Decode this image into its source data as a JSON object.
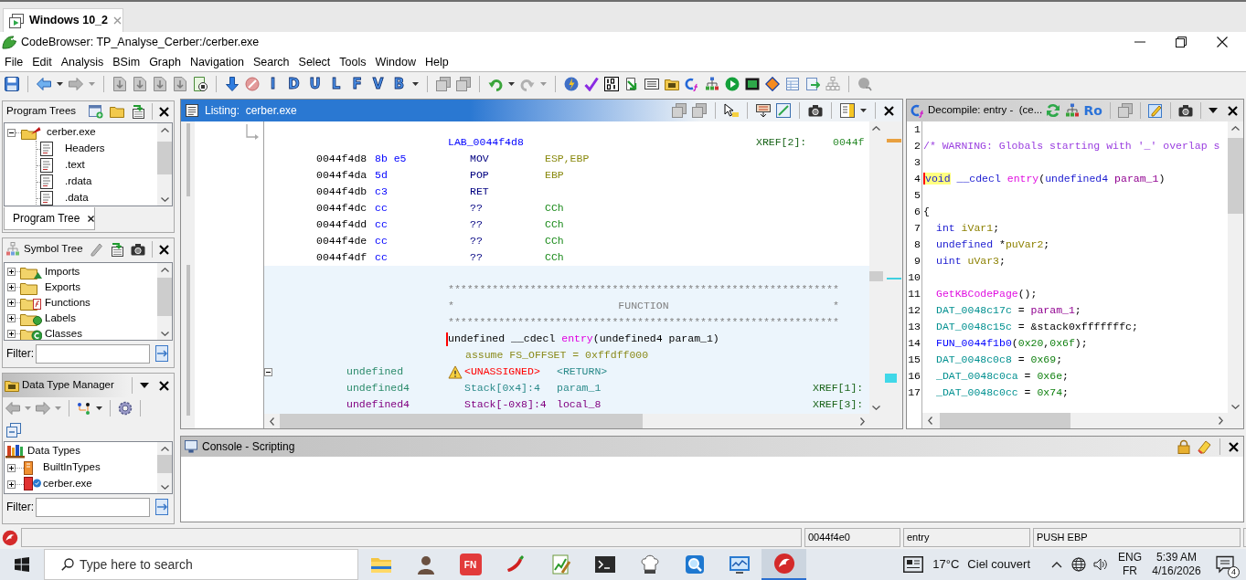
{
  "tabs": [
    {
      "title": "Windows 10_2",
      "selected": true
    }
  ],
  "window": {
    "title": "CodeBrowser: TP_Analyse_Cerber:/cerber.exe"
  },
  "menu": [
    "File",
    "Edit",
    "Analysis",
    "BSim",
    "Graph",
    "Navigation",
    "Search",
    "Select",
    "Tools",
    "Window",
    "Help"
  ],
  "toolbar": {
    "letter_buttons": [
      "I",
      "D",
      "U",
      "L",
      "F",
      "V",
      "B"
    ]
  },
  "program_trees": {
    "title": "Program Trees",
    "tree": [
      {
        "label": "cerber.exe",
        "expanded": true,
        "children": [
          {
            "label": "Headers"
          },
          {
            "label": ".text"
          },
          {
            "label": ".rdata"
          },
          {
            "label": ".data"
          }
        ]
      }
    ],
    "tabs": [
      {
        "label": "Program Tree",
        "selected": true
      }
    ]
  },
  "symbol_tree": {
    "title": "Symbol Tree",
    "items": [
      {
        "label": "Imports",
        "expanded": false
      },
      {
        "label": "Exports",
        "expanded": false
      },
      {
        "label": "Functions",
        "expanded": false
      },
      {
        "label": "Labels",
        "expanded": false
      },
      {
        "label": "Classes",
        "expanded": false
      }
    ],
    "filter_label": "Filter:"
  },
  "data_type_manager": {
    "title": "Data Type Manager",
    "tree": [
      {
        "label": "Data Types",
        "children": [
          {
            "label": "BuiltInTypes",
            "expanded": false
          },
          {
            "label": "cerber.exe",
            "expanded": false
          }
        ]
      }
    ],
    "filter_label": "Filter:"
  },
  "listing": {
    "title": "Listing:  cerber.exe",
    "rows": [
      {
        "kind": "label",
        "label": "LAB_0044f4d8",
        "xref": "XREF[2]:",
        "xref_target": "0044f"
      },
      {
        "kind": "instruction",
        "address": "0044f4d8",
        "bytes": "8b e5",
        "mnemonic": "MOV",
        "operands": {
          "text": "ESP,EBP",
          "kind": "register"
        }
      },
      {
        "kind": "instruction",
        "address": "0044f4da",
        "bytes": "5d",
        "mnemonic": "POP",
        "operands": {
          "text": "EBP",
          "kind": "register"
        }
      },
      {
        "kind": "instruction",
        "address": "0044f4db",
        "bytes": "c3",
        "mnemonic": "RET"
      },
      {
        "kind": "instruction",
        "address": "0044f4dc",
        "bytes": "cc",
        "mnemonic": "??",
        "operands": {
          "text": "CCh",
          "kind": "scalar"
        }
      },
      {
        "kind": "instruction",
        "address": "0044f4dd",
        "bytes": "cc",
        "mnemonic": "??",
        "operands": {
          "text": "CCh",
          "kind": "scalar"
        }
      },
      {
        "kind": "instruction",
        "address": "0044f4de",
        "bytes": "cc",
        "mnemonic": "??",
        "operands": {
          "text": "CCh",
          "kind": "scalar"
        }
      },
      {
        "kind": "instruction",
        "address": "0044f4df",
        "bytes": "cc",
        "mnemonic": "??",
        "operands": {
          "text": "CCh",
          "kind": "scalar"
        }
      }
    ],
    "function": {
      "expanded": true,
      "banner_top": "**************************************************************",
      "banner_title": "*                          FUNCTION                          *",
      "banner_bottom": "**************************************************************",
      "signature": {
        "return_type": "undefined",
        "convention": "__cdecl",
        "name": "entry",
        "parameters": "(undefined4 param_1)"
      },
      "assume": "assume FS_OFFSET = 0xffdff000",
      "variables": [
        {
          "kind": "return",
          "type": "undefined",
          "storage": "<UNASSIGNED>",
          "name": "<RETURN>",
          "warning": true
        },
        {
          "kind": "parameter",
          "type": "undefined4",
          "storage": "Stack[0x4]:4",
          "name": "param_1",
          "xref": "XREF[1]:",
          "warning": false
        },
        {
          "kind": "local",
          "type": "undefined4",
          "storage": "Stack[-0x8]:4",
          "name": "local_8",
          "xref": "XREF[3]:",
          "warning": false
        }
      ]
    }
  },
  "decompile": {
    "title": "Decompile: entry -  (ce...",
    "read_only": "Ro",
    "lines": [
      {
        "number": "1"
      },
      {
        "number": "2",
        "indented": false,
        "tokens": [
          {
            "text": "/* WARNING: Globals starting with '_' overlap s",
            "kind": "comment",
            "highlighted": false
          }
        ]
      },
      {
        "number": "3"
      },
      {
        "number": "4",
        "indented": false,
        "tokens": [
          {
            "text": "void",
            "kind": "type",
            "highlighted": true
          },
          {
            "text": " __cdecl ",
            "kind": "type",
            "highlighted": false
          },
          {
            "text": "entry",
            "kind": "function",
            "highlighted": false
          },
          {
            "text": "(",
            "kind": "plain",
            "highlighted": false
          },
          {
            "text": "undefined4",
            "kind": "type",
            "highlighted": false
          },
          {
            "text": " param_1",
            "kind": "param",
            "highlighted": false
          },
          {
            "text": ")",
            "kind": "plain",
            "highlighted": false
          }
        ]
      },
      {
        "number": "5"
      },
      {
        "number": "6",
        "indented": false,
        "tokens": [
          {
            "text": "{",
            "kind": "plain",
            "highlighted": false
          }
        ]
      },
      {
        "number": "7",
        "indented": true,
        "tokens": [
          {
            "text": "int",
            "kind": "type",
            "highlighted": false
          },
          {
            "text": " iVar1",
            "kind": "local",
            "highlighted": false
          },
          {
            "text": ";",
            "kind": "plain",
            "highlighted": false
          }
        ]
      },
      {
        "number": "8",
        "indented": true,
        "tokens": [
          {
            "text": "undefined",
            "kind": "type",
            "highlighted": false
          },
          {
            "text": " *",
            "kind": "plain",
            "highlighted": false
          },
          {
            "text": "puVar2",
            "kind": "local",
            "highlighted": false
          },
          {
            "text": ";",
            "kind": "plain",
            "highlighted": false
          }
        ]
      },
      {
        "number": "9",
        "indented": true,
        "tokens": [
          {
            "text": "uint",
            "kind": "type",
            "highlighted": false
          },
          {
            "text": " uVar3",
            "kind": "local",
            "highlighted": false
          },
          {
            "text": ";",
            "kind": "plain",
            "highlighted": false
          }
        ]
      },
      {
        "number": "10"
      },
      {
        "number": "11",
        "indented": true,
        "tokens": [
          {
            "text": "GetKBCodePage",
            "kind": "function",
            "highlighted": false
          },
          {
            "text": "();",
            "kind": "plain",
            "highlighted": false
          }
        ]
      },
      {
        "number": "12",
        "indented": true,
        "tokens": [
          {
            "text": "DAT_0048c17c",
            "kind": "global",
            "highlighted": false
          },
          {
            "text": " = ",
            "kind": "plain",
            "highlighted": false
          },
          {
            "text": "param_1",
            "kind": "param",
            "highlighted": false
          },
          {
            "text": ";",
            "kind": "plain",
            "highlighted": false
          }
        ]
      },
      {
        "number": "13",
        "indented": true,
        "tokens": [
          {
            "text": "DAT_0048c15c",
            "kind": "global",
            "highlighted": false
          },
          {
            "text": " = &stack0xfffffffc;",
            "kind": "plain",
            "highlighted": false
          }
        ]
      },
      {
        "number": "14",
        "indented": true,
        "tokens": [
          {
            "text": "FUN_0044f1b0",
            "kind": "call",
            "highlighted": false
          },
          {
            "text": "(",
            "kind": "plain",
            "highlighted": false
          },
          {
            "text": "0x20",
            "kind": "constant",
            "highlighted": false
          },
          {
            "text": ",",
            "kind": "plain",
            "highlighted": false
          },
          {
            "text": "0x6f",
            "kind": "constant",
            "highlighted": false
          },
          {
            "text": ");",
            "kind": "plain",
            "highlighted": false
          }
        ]
      },
      {
        "number": "15",
        "indented": true,
        "tokens": [
          {
            "text": "DAT_0048c0c8",
            "kind": "global",
            "highlighted": false
          },
          {
            "text": " = ",
            "kind": "plain",
            "highlighted": false
          },
          {
            "text": "0x69",
            "kind": "constant",
            "highlighted": false
          },
          {
            "text": ";",
            "kind": "plain",
            "highlighted": false
          }
        ]
      },
      {
        "number": "16",
        "indented": true,
        "tokens": [
          {
            "text": "_DAT_0048c0ca",
            "kind": "global",
            "highlighted": false
          },
          {
            "text": " = ",
            "kind": "plain",
            "highlighted": false
          },
          {
            "text": "0x6e",
            "kind": "constant",
            "highlighted": false
          },
          {
            "text": ";",
            "kind": "plain",
            "highlighted": false
          }
        ]
      },
      {
        "number": "17",
        "indented": true,
        "tokens": [
          {
            "text": "_DAT_0048c0cc",
            "kind": "global",
            "highlighted": false
          },
          {
            "text": " = ",
            "kind": "plain",
            "highlighted": false
          },
          {
            "text": "0x74",
            "kind": "constant",
            "highlighted": false
          },
          {
            "text": ";",
            "kind": "plain",
            "highlighted": false
          }
        ]
      }
    ]
  },
  "console": {
    "title": "Console - Scripting"
  },
  "status_bar": {
    "fields": [
      "0044f4e0",
      "entry",
      "PUSH EBP"
    ]
  },
  "taskbar": {
    "search_placeholder": "Type here to search",
    "apps": [
      {
        "selected": false
      },
      {
        "selected": false
      },
      {
        "label": "FN",
        "selected": false
      },
      {
        "selected": false
      },
      {
        "selected": false
      },
      {
        "selected": false
      },
      {
        "selected": false
      },
      {
        "selected": false
      },
      {
        "selected": false
      },
      {
        "selected": true
      }
    ],
    "weather": {
      "temperature": "17°C",
      "condition": "Ciel couvert"
    },
    "language": {
      "input": "ENG",
      "layout": "FR"
    },
    "clock": {
      "time": "5:39 AM",
      "date": "4/16/2026"
    },
    "notification_count": "4"
  }
}
